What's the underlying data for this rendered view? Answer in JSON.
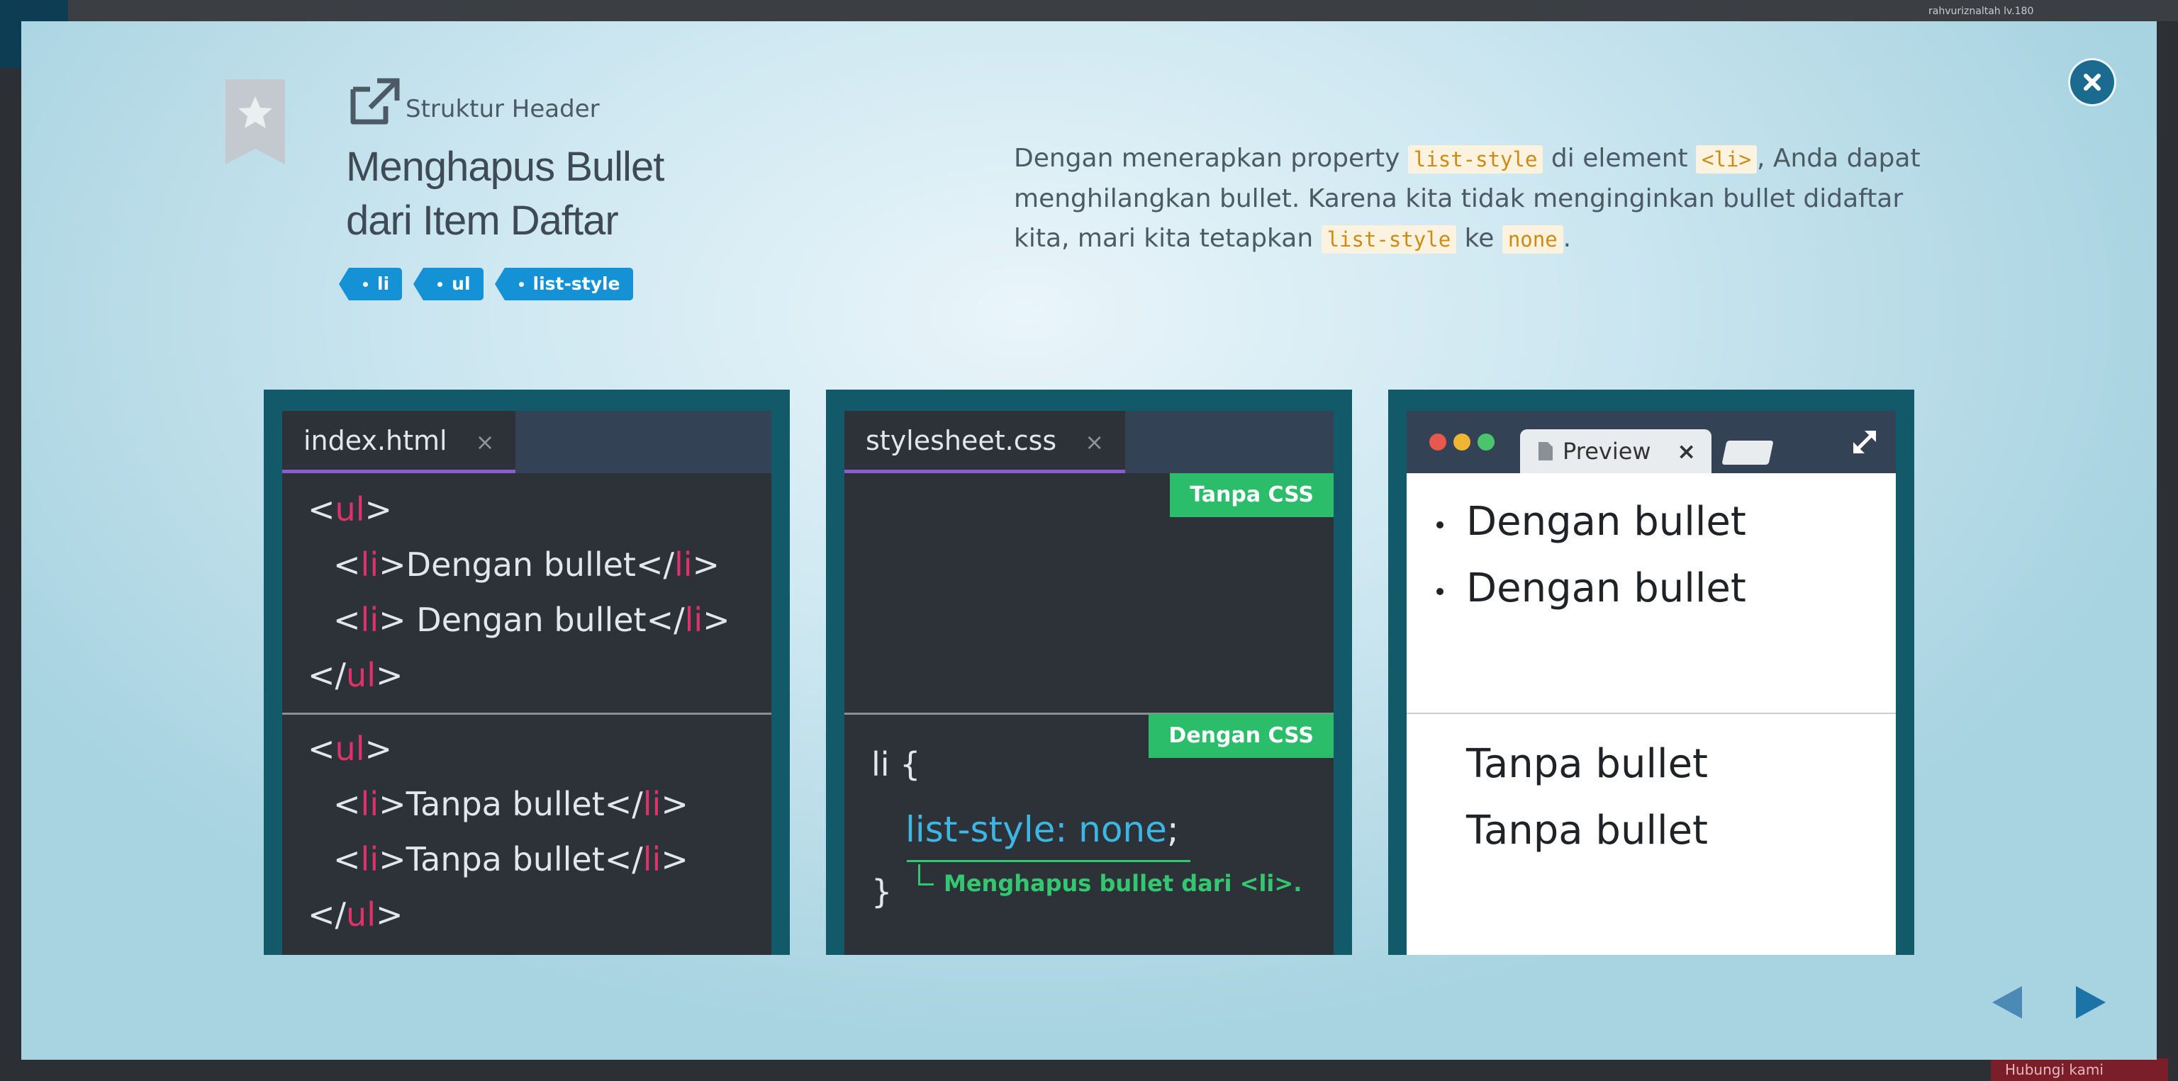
{
  "background": {
    "user_label": "rahvuriznaltah lv.180",
    "footer_label": "Hubungi kami"
  },
  "header": {
    "section_label": "Struktur Header",
    "title_line1": "Menghapus Bullet",
    "title_line2": "dari Item Daftar",
    "tags": [
      "li",
      "ul",
      "list-style"
    ]
  },
  "description": {
    "part1": "Dengan menerapkan property ",
    "code1": "list-style",
    "part2": " di element ",
    "code2": "<li>",
    "part3": ", Anda dapat menghilangkan bullet. Karena kita tidak menginginkan bullet didaftar kita, mari kita tetapkan ",
    "code3": "list-style",
    "part4": " ke ",
    "code4": "none",
    "part5": "."
  },
  "html_panel": {
    "tab_label": "index.html",
    "close_glyph": "×",
    "block1": [
      "<ul>",
      "<li>Dengan bullet</li>",
      "<li> Dengan bullet</li>",
      "</ul>"
    ],
    "block2": [
      "<ul>",
      "<li>Tanpa bullet</li>",
      "<li>Tanpa bullet</li>",
      "</ul>"
    ]
  },
  "css_panel": {
    "tab_label": "stylesheet.css",
    "close_glyph": "×",
    "badge_without": "Tanpa CSS",
    "badge_with": "Dengan CSS",
    "selector": "li {",
    "property": "list-style",
    "colon": ":",
    "value": "none",
    "semicolon": ";",
    "closing": "}",
    "note": "Menghapus bullet dari <li>."
  },
  "preview_panel": {
    "tab_label": "Preview",
    "close_glyph": "×",
    "with_bullets": [
      "Dengan bullet",
      "Dengan bullet"
    ],
    "without_bullets": [
      "Tanpa bullet",
      "Tanpa bullet"
    ]
  },
  "colors": {
    "accent_blue": "#1592d6",
    "tag_color": "#1592d6",
    "badge_green": "#2cbd6b",
    "code_pink": "#e0326a",
    "panel_border": "#125a6a"
  }
}
